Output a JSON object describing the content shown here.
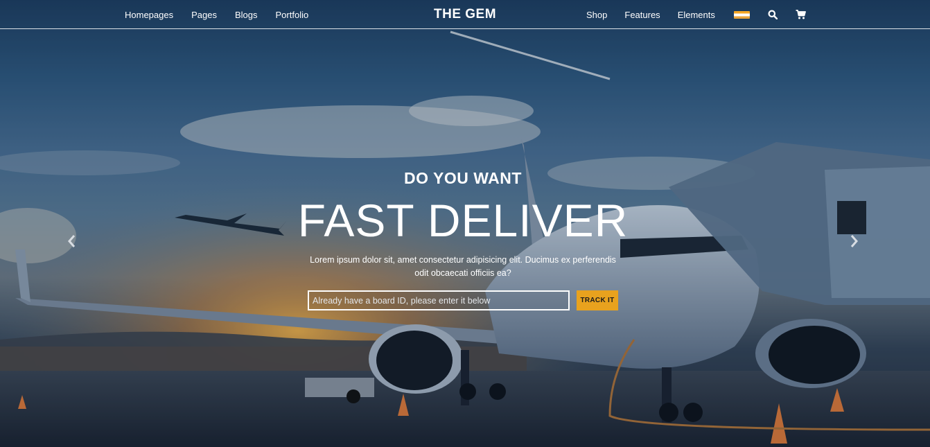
{
  "header": {
    "logo": "THE GEM",
    "nav_left": [
      "Homepages",
      "Pages",
      "Blogs",
      "Portfolio"
    ],
    "nav_right": [
      "Shop",
      "Features",
      "Elements"
    ],
    "icons": [
      "flag-icon",
      "search-icon",
      "cart-icon"
    ]
  },
  "hero": {
    "kicker": "DO YOU WANT",
    "headline": "FAST DELIVER",
    "description": "Lorem ipsum dolor sit, amet consectetur adipisicing elit. Ducimus ex perferendis odit obcaecati officiis ea?",
    "track_placeholder": "Already have a board ID, please enter it below",
    "track_value": "",
    "track_button": "TRACK IT",
    "prev_icon": "chevron-left-icon",
    "next_icon": "chevron-right-icon"
  },
  "colors": {
    "accent": "#e8a21e",
    "header_border": "#ffffff"
  }
}
